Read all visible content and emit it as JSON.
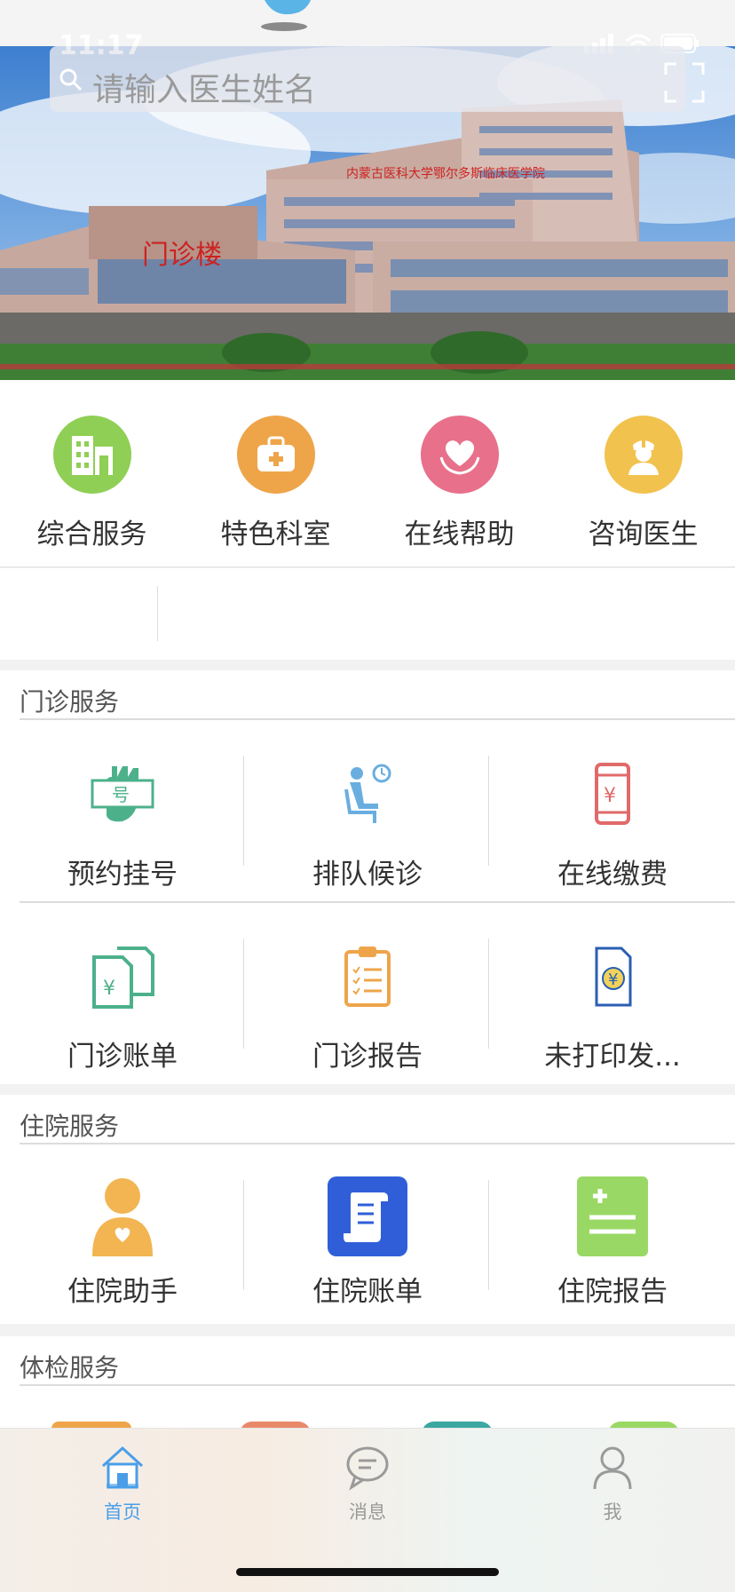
{
  "status_bar": {
    "time": "11:17"
  },
  "search": {
    "placeholder": "请输入医生姓名"
  },
  "banner": {
    "building_sign": "门诊楼",
    "hospital_name": "内蒙古医科大学鄂尔多斯临床医学院"
  },
  "quick_nav": [
    {
      "label": "综合服务",
      "icon": "hospital-building-icon",
      "color": "#8fcf55"
    },
    {
      "label": "特色科室",
      "icon": "medical-kit-icon",
      "color": "#eea54a"
    },
    {
      "label": "在线帮助",
      "icon": "heart-hands-icon",
      "color": "#e8708a"
    },
    {
      "label": "咨询医生",
      "icon": "doctor-icon",
      "color": "#f2c24f"
    }
  ],
  "outpatient": {
    "title": "门诊服务",
    "items": [
      {
        "label": "预约挂号",
        "icon": "hand-number-icon"
      },
      {
        "label": "排队候诊",
        "icon": "waiting-seat-icon"
      },
      {
        "label": "在线缴费",
        "icon": "phone-payment-icon"
      },
      {
        "label": "门诊账单",
        "icon": "bill-document-icon"
      },
      {
        "label": "门诊报告",
        "icon": "clipboard-report-icon"
      },
      {
        "label": "未打印发...",
        "icon": "invoice-icon"
      }
    ]
  },
  "inpatient": {
    "title": "住院服务",
    "items": [
      {
        "label": "住院助手",
        "icon": "assistant-person-icon"
      },
      {
        "label": "住院账单",
        "icon": "scroll-bill-icon"
      },
      {
        "label": "住院报告",
        "icon": "report-list-icon"
      }
    ]
  },
  "checkup": {
    "title": "体检服务"
  },
  "tabbar": [
    {
      "label": "首页",
      "icon": "home-icon",
      "active": true
    },
    {
      "label": "消息",
      "icon": "message-icon",
      "active": false
    },
    {
      "label": "我",
      "icon": "profile-icon",
      "active": false
    }
  ],
  "colors": {
    "accent": "#4a9ee8",
    "tab_inactive": "#9a9a9a"
  }
}
